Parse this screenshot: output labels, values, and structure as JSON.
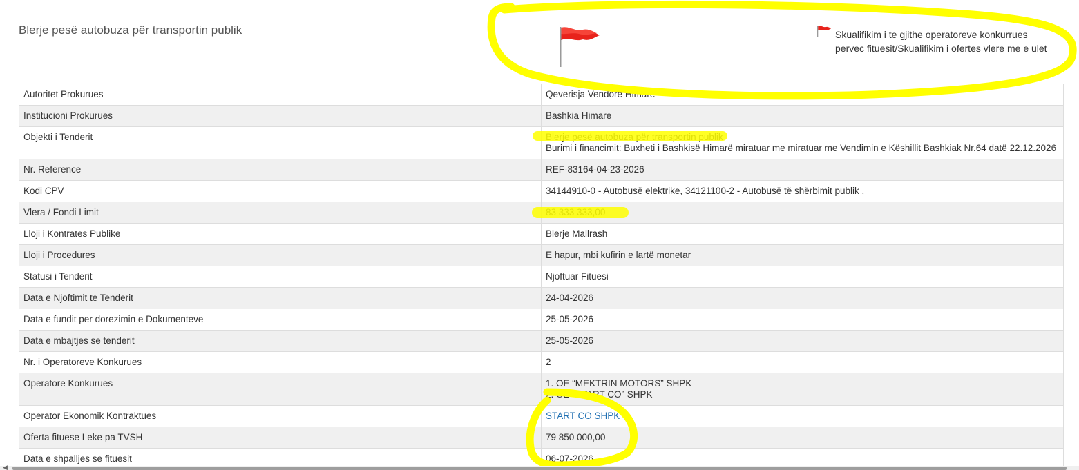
{
  "header": {
    "title": "Blerje pesë autobuza për transportin publik",
    "flag_note": "Skualifikim i te gjithe operatoreve konkurrues pervec fituesit/Skualifikim i ofertes vlere me e ulet"
  },
  "colors": {
    "flag_red": "#e8231c",
    "highlight_yellow": "#ffff00",
    "link_blue": "#1f6fb2",
    "row_alt_bg": "#f0f0f0",
    "border": "#dddddd"
  },
  "icons": {
    "big_flag": "red-flag-icon",
    "small_flag": "red-flag-icon",
    "scroll_left": "left-arrow-icon"
  },
  "rows": [
    {
      "label": "Autoritet Prokurues",
      "value": "Qeverisja Vendore Himarë"
    },
    {
      "label": "Institucioni Prokurues",
      "value": "Bashkia Himare"
    },
    {
      "label": "Objekti i Tenderit",
      "value": "Blerje pesë autobuza për transportin publik",
      "value2": "Burimi i financimit: Buxheti i Bashkisë Himarë miratuar me miratuar me Vendimin e Këshillit Bashkiak Nr.64 datë 22.12.2026"
    },
    {
      "label": "Nr. Reference",
      "value": "REF-83164-04-23-2026"
    },
    {
      "label": "Kodi CPV",
      "value": "34144910-0 - Autobusë elektrike, 34121100-2 - Autobusë të shërbimit publik ,"
    },
    {
      "label": "Vlera / Fondi Limit",
      "value": "83 333 333,00"
    },
    {
      "label": "Lloji i Kontrates Publike",
      "value": "Blerje Mallrash"
    },
    {
      "label": "Lloji i Procedures",
      "value": "E hapur, mbi kufirin e lartë monetar"
    },
    {
      "label": "Statusi i Tenderit",
      "value": "Njoftuar Fituesi"
    },
    {
      "label": "Data e Njoftimit te Tenderit",
      "value": "24-04-2026"
    },
    {
      "label": "Data e fundit per dorezimin e Dokumenteve",
      "value": "25-05-2026"
    },
    {
      "label": "Data e mbajtjes se tenderit",
      "value": "25-05-2026"
    },
    {
      "label": "Nr. i Operatoreve Konkurues",
      "value": "2"
    },
    {
      "label": "Operatore Konkurues",
      "value": "1. OE “MEKTRIN MOTORS” SHPK",
      "value2": "2. OE “START CO” SHPK"
    },
    {
      "label": "Operator Ekonomik Kontraktues",
      "value": "START CO SHPK"
    },
    {
      "label": "Oferta fituese Leke pa TVSH",
      "value": "79 850 000,00"
    },
    {
      "label": "Data e shpalljes se fituesit",
      "value": "06-07-2026"
    }
  ]
}
